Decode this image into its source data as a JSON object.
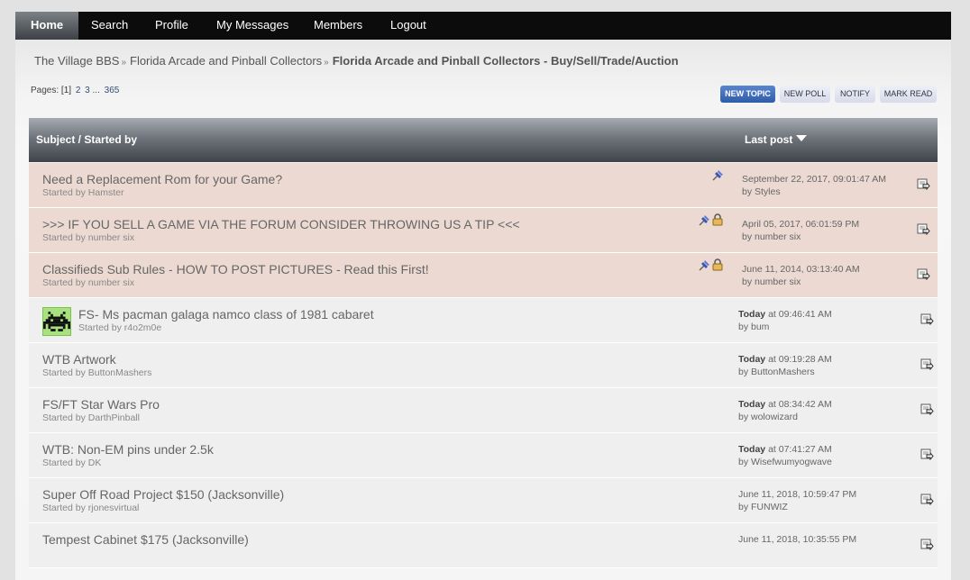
{
  "nav": [
    "Home",
    "Search",
    "Profile",
    "My Messages",
    "Members",
    "Logout"
  ],
  "breadcrumb": {
    "crumb1": "The Village BBS",
    "crumb2": "Florida Arcade and Pinball Collectors",
    "sep": "»",
    "current": "Florida Arcade and Pinball Collectors - Buy/Sell/Trade/Auction"
  },
  "pagination": {
    "label": "Pages:",
    "current": "[1]",
    "p2": "2",
    "p3": "3",
    "ellipsis": "...",
    "last": "365"
  },
  "buttons": {
    "new_topic": "NEW TOPIC",
    "new_poll": "NEW POLL",
    "notify": "NOTIFY",
    "mark_read": "MARK READ"
  },
  "table": {
    "col_subject": "Subject / Started by",
    "col_lastpost": "Last post"
  },
  "topics": [
    {
      "subject": "Need a Replacement Rom for your Game?",
      "starter": "Started by Hamster",
      "last_bold": "",
      "last_date": "September 22, 2017, 09:01:47 AM",
      "last_by": "by Styles",
      "sticky": true,
      "locked": false
    },
    {
      "subject": ">>> IF YOU SELL A GAME VIA THE FORUM CONSIDER THROWING US A TIP <<<",
      "starter": "Started by number six",
      "last_bold": "",
      "last_date": "April 05, 2017, 06:01:59 PM",
      "last_by": "by number six",
      "sticky": true,
      "locked": true
    },
    {
      "subject": "Classifieds Sub Rules - HOW TO POST PICTURES - Read this First!",
      "starter": "Started by number six",
      "last_bold": "",
      "last_date": "June 11, 2014, 03:13:40 AM",
      "last_by": "by number six",
      "sticky": true,
      "locked": true
    },
    {
      "subject": "FS- Ms pacman galaga namco class of 1981 cabaret",
      "starter": "Started by r4o2m0e",
      "last_bold": "Today",
      "last_date": " at 09:46:41 AM",
      "last_by": "by bum",
      "sticky": false,
      "locked": false,
      "avatar": true
    },
    {
      "subject": "WTB Artwork",
      "starter": "Started by ButtonMashers",
      "last_bold": "Today",
      "last_date": " at 09:19:28 AM",
      "last_by": "by ButtonMashers",
      "sticky": false,
      "locked": false
    },
    {
      "subject": "FS/FT Star Wars Pro",
      "starter": "Started by DarthPinball",
      "last_bold": "Today",
      "last_date": " at 08:34:42 AM",
      "last_by": "by wolowizard",
      "sticky": false,
      "locked": false
    },
    {
      "subject": "WTB: Non-EM pins under 2.5k",
      "starter": "Started by DK",
      "last_bold": "Today",
      "last_date": " at 07:41:27 AM",
      "last_by": "by Wisefwumyogwave",
      "sticky": false,
      "locked": false
    },
    {
      "subject": "Super Off Road Project $150 (Jacksonville)",
      "starter": "Started by rjonesvirtual",
      "last_bold": "",
      "last_date": "June 11, 2018, 10:59:47 PM",
      "last_by": "by FUNWIZ",
      "sticky": false,
      "locked": false
    },
    {
      "subject": "Tempest Cabinet $175 (Jacksonville)",
      "starter": "",
      "last_bold": "",
      "last_date": "June 11, 2018, 10:35:55 PM",
      "last_by": "",
      "sticky": false,
      "locked": false
    }
  ],
  "colors": {
    "sticky_row": "#ecdad2",
    "normal_row": "#efefef",
    "primary_button": "#2f5ca8",
    "header_dark": "#3f444a"
  },
  "icons": {
    "pin": "pushpin-icon",
    "lock": "lock-icon",
    "goto": "last-post-icon",
    "sort": "sort-desc-icon"
  }
}
